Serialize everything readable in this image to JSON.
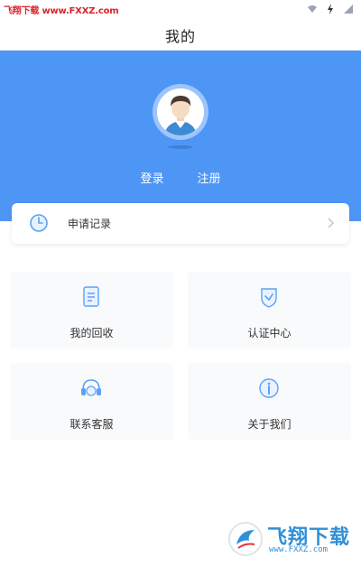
{
  "status_bar": {
    "watermark": "飞翔下载 www.FXXZ.com",
    "icons": [
      "wifi-icon",
      "lightning-icon",
      "signal-icon"
    ]
  },
  "header": {
    "title": "我的"
  },
  "profile": {
    "login_label": "登录",
    "register_label": "注册",
    "hero_color": "#4e96f6"
  },
  "record": {
    "label": "申请记录",
    "icon": "history-icon",
    "arrow": "chevron-right-icon"
  },
  "tiles": [
    {
      "label": "我的回收",
      "icon": "document-icon"
    },
    {
      "label": "认证中心",
      "icon": "shield-check-icon"
    },
    {
      "label": "联系客服",
      "icon": "headset-icon"
    },
    {
      "label": "关于我们",
      "icon": "info-icon"
    }
  ],
  "footer_logo": {
    "name": "飞翔下载",
    "url": "www.FXXZ.com"
  },
  "colors": {
    "accent": "#4e96f6",
    "icon_blue": "#5aa2f8",
    "tile_bg": "#f9fafc"
  }
}
